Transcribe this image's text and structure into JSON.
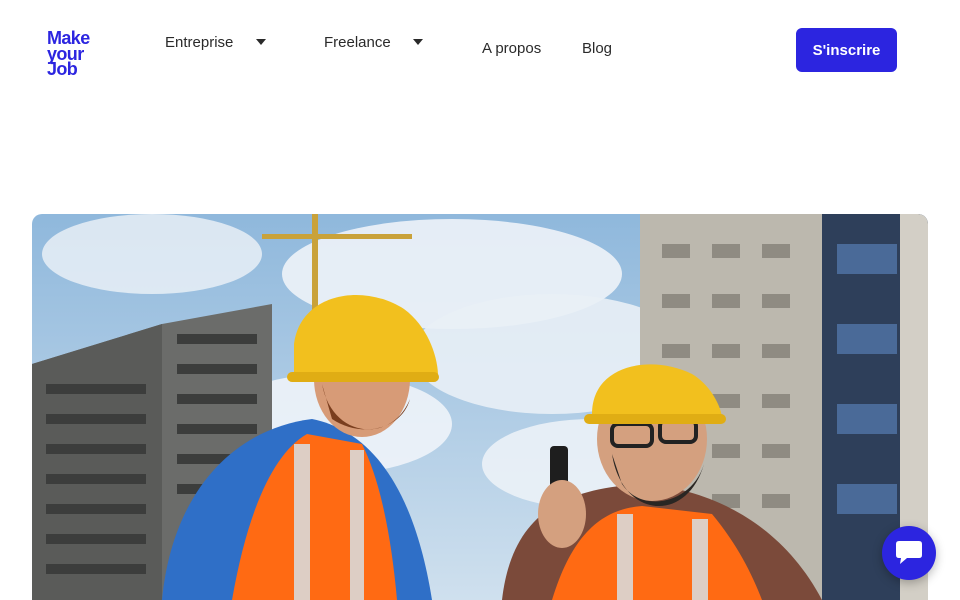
{
  "header": {
    "logo": {
      "line1": "Make",
      "line2": "your",
      "line3": "Job"
    },
    "nav": {
      "entreprise": "Entreprise",
      "freelance": "Freelance",
      "apropos": "A propos",
      "blog": "Blog"
    },
    "cta_label": "S'inscrire"
  },
  "hero": {
    "image": "construction-workers-photo"
  },
  "chat": {
    "icon": "chat-icon"
  },
  "colors": {
    "brand": "#2c25e0",
    "text": "#2a2a2a",
    "background": "#ffffff"
  }
}
